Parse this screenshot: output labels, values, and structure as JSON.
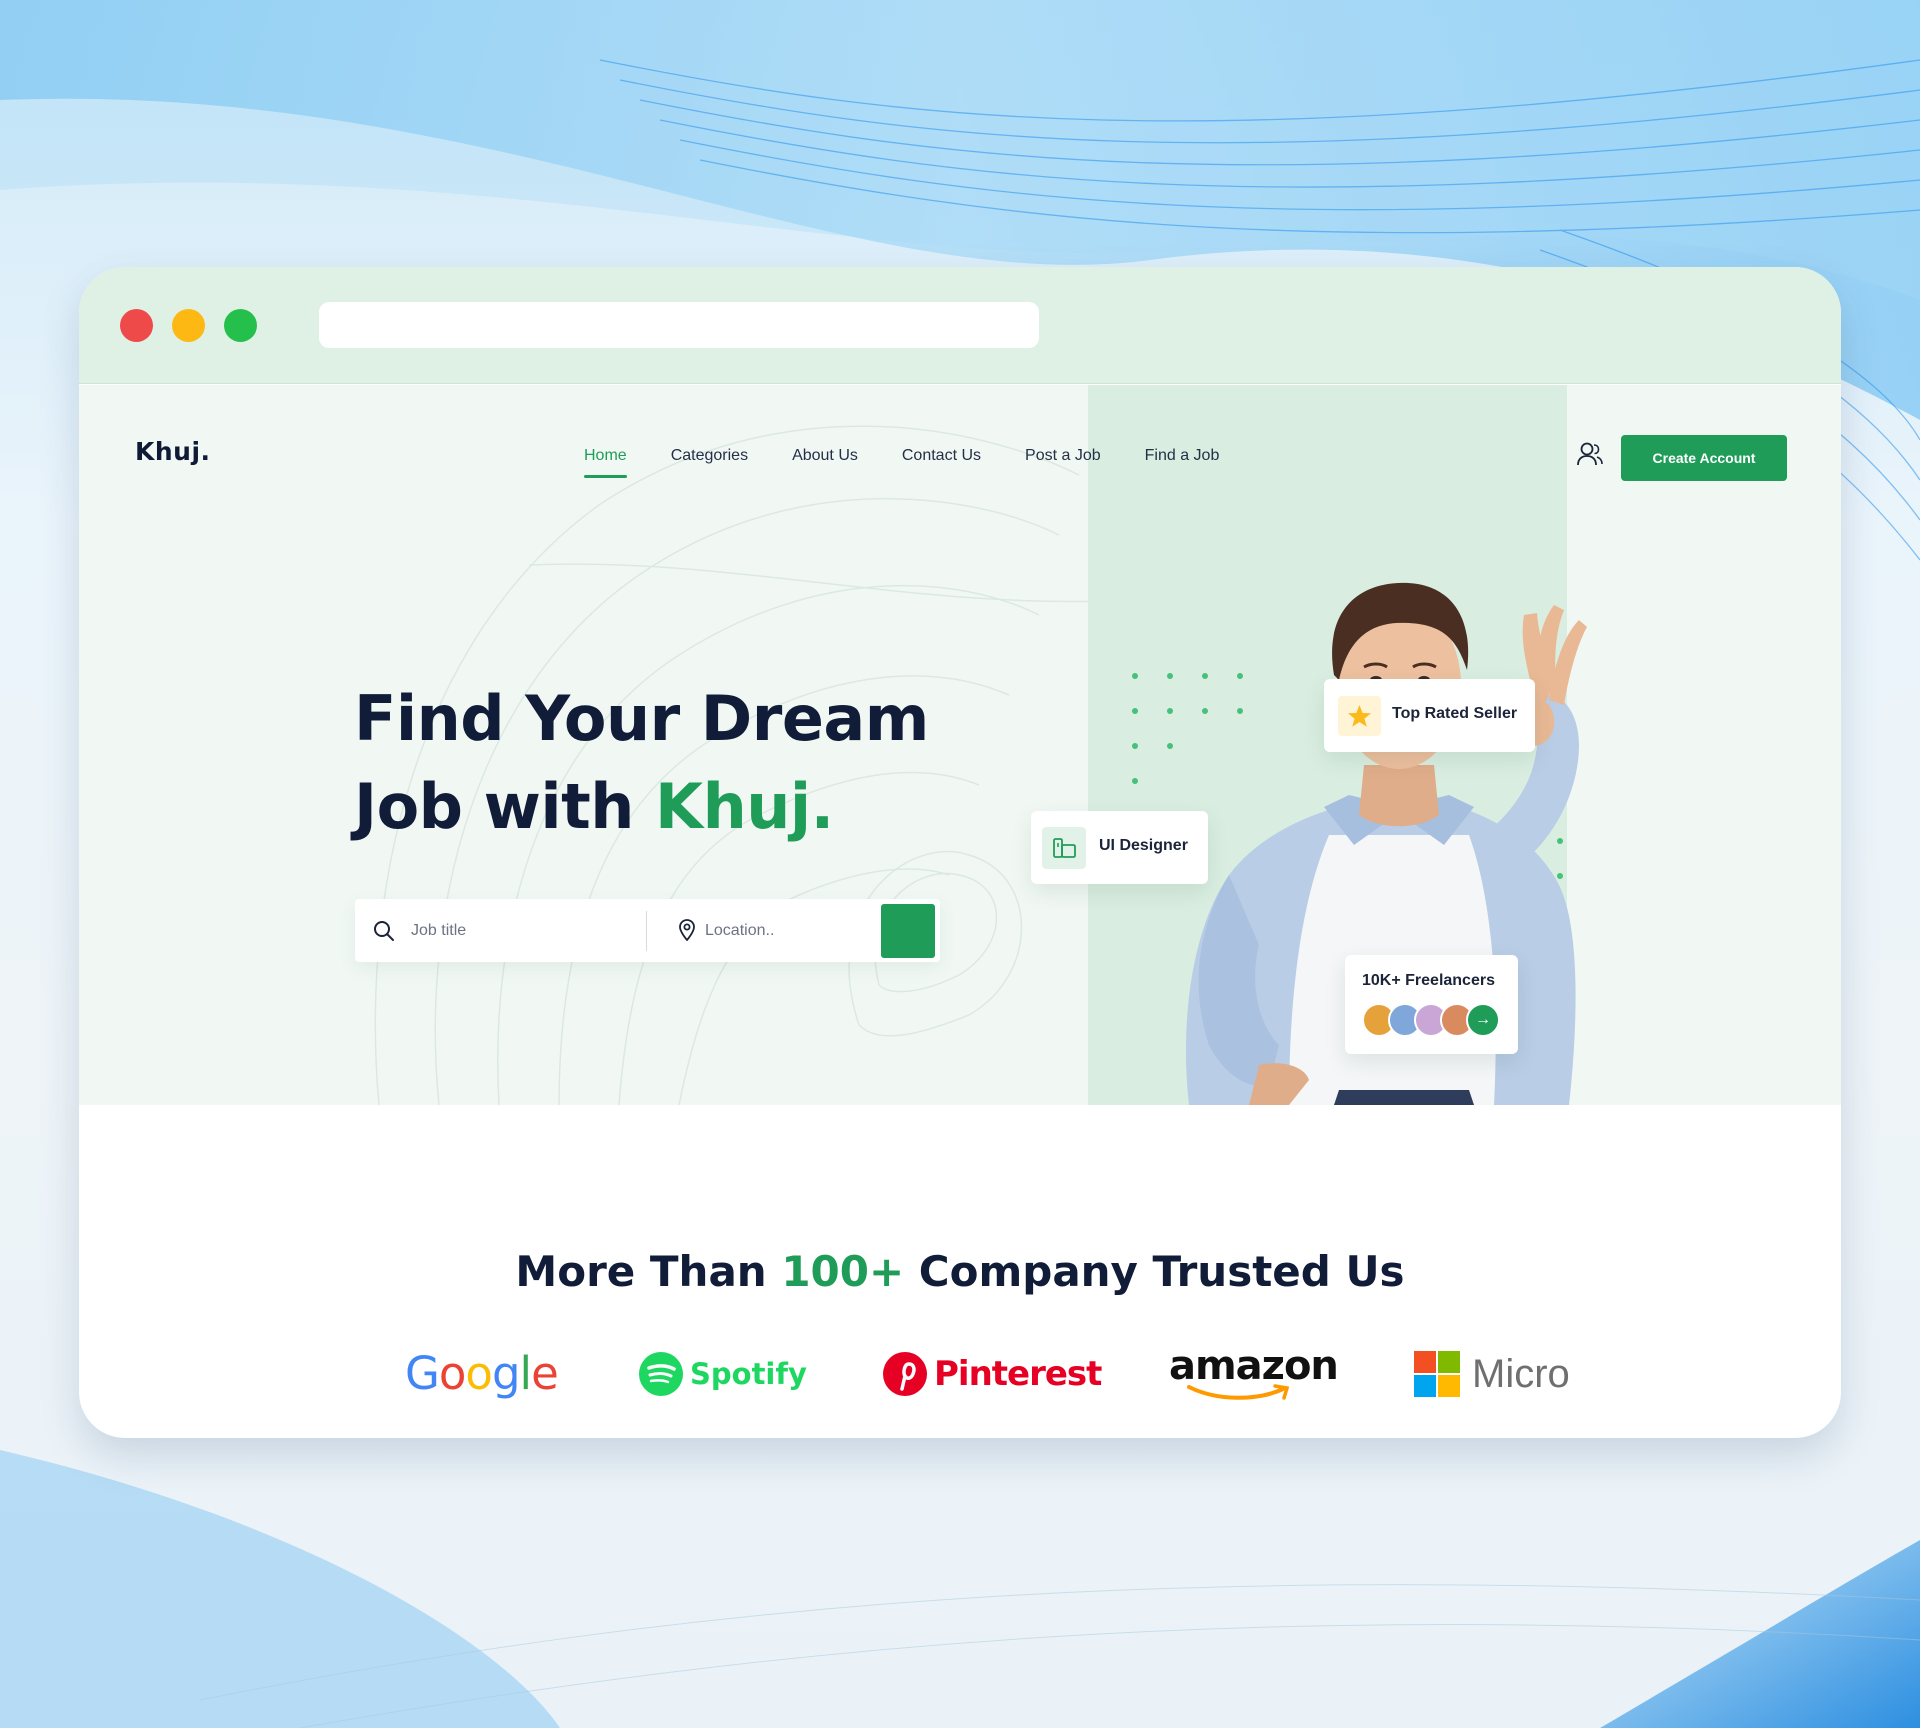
{
  "browser": {
    "url": ""
  },
  "site": {
    "logo": "Khuj."
  },
  "nav": {
    "items": [
      {
        "label": "Home",
        "active": true
      },
      {
        "label": "Categories",
        "active": false
      },
      {
        "label": "About Us",
        "active": false
      },
      {
        "label": "Contact Us",
        "active": false
      },
      {
        "label": "Post a Job",
        "active": false
      },
      {
        "label": "Find a Job",
        "active": false
      }
    ],
    "create_account": "Create Account"
  },
  "hero": {
    "headline_line1": "Find Your Dream",
    "headline_line2_prefix": "Job with ",
    "headline_brand": "Khuj.",
    "search": {
      "job_placeholder": "Job title",
      "location_placeholder": "Location.."
    },
    "badges": {
      "top_rated": "Top Rated Seller",
      "role": "UI Designer",
      "freelancers": "10K+ Freelancers"
    }
  },
  "trusted": {
    "prefix": "More Than ",
    "count": "100+",
    "suffix": " Company Trusted Us",
    "companies": {
      "google": "Google",
      "spotify": "Spotify",
      "pinterest": "Pinterest",
      "amazon": "amazon",
      "microsoft": "Micro"
    }
  },
  "colors": {
    "accent": "#1f9d58",
    "heading": "#111c38",
    "hero_bg": "#f1f8f4",
    "hero_panel": "#d9eee1",
    "chrome_bar": "#dff0e5"
  },
  "icons": {
    "search": "search-icon",
    "location": "location-pin-icon",
    "user": "user-icon",
    "star": "star-icon",
    "design": "design-tool-icon",
    "arrow": "arrow-right-icon"
  }
}
